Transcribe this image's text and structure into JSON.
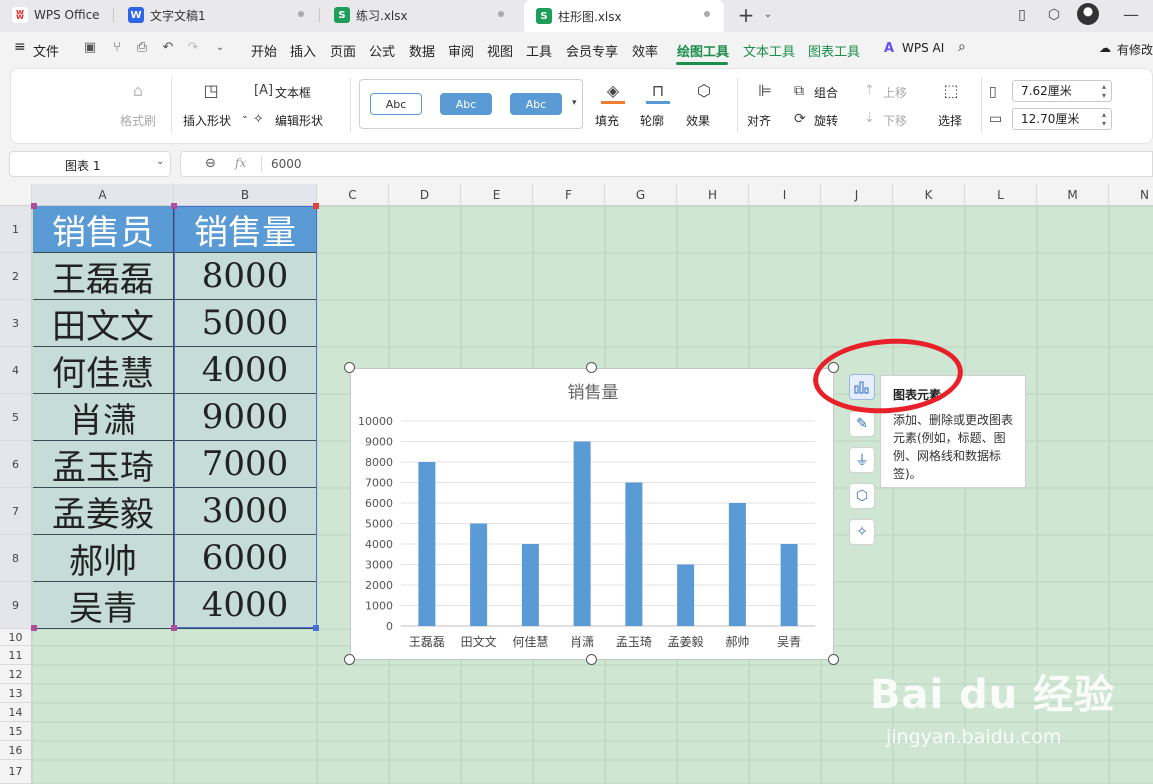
{
  "tabs": [
    {
      "label": "WPS Office",
      "logo": "W"
    },
    {
      "label": "文字文稿1",
      "logo": "W"
    },
    {
      "label": "练习.xlsx",
      "logo": "S"
    },
    {
      "label": "柱形图.xlsx",
      "logo": "S"
    }
  ],
  "menu": {
    "file": "文件",
    "items": [
      "开始",
      "插入",
      "页面",
      "公式",
      "数据",
      "审阅",
      "视图",
      "工具",
      "会员专享",
      "效率"
    ],
    "context_tabs": [
      "绘图工具",
      "文本工具",
      "图表工具"
    ],
    "wps_ai": "WPS AI",
    "modify": "有修改"
  },
  "ribbon": {
    "format_painter": "格式刷",
    "insert_shape": "插入形状",
    "text_box": "文本框",
    "edit_shape": "编辑形状",
    "style_samples": [
      "Abc",
      "Abc",
      "Abc"
    ],
    "fill": "填充",
    "outline": "轮廓",
    "effect": "效果",
    "align": "对齐",
    "group": "组合",
    "rotate": "旋转",
    "bring_forward": "上移",
    "send_backward": "下移",
    "select": "选择",
    "height": "7.62厘米",
    "width": "12.70厘米"
  },
  "formula_bar": {
    "name_box": "图表 1",
    "fx": "fx",
    "value": "6000"
  },
  "columns": [
    "A",
    "B",
    "C",
    "D",
    "E",
    "F",
    "G",
    "H",
    "I",
    "J",
    "K",
    "L",
    "M",
    "N"
  ],
  "rows": [
    "1",
    "2",
    "3",
    "4",
    "5",
    "6",
    "7",
    "8",
    "9",
    "10",
    "11",
    "12",
    "13",
    "14",
    "15",
    "16",
    "17"
  ],
  "table": {
    "headers": [
      "销售员",
      "销售量"
    ],
    "rows": [
      [
        "王磊磊",
        "8000"
      ],
      [
        "田文文",
        "5000"
      ],
      [
        "何佳慧",
        "4000"
      ],
      [
        "肖潇",
        "9000"
      ],
      [
        "孟玉琦",
        "7000"
      ],
      [
        "孟姜毅",
        "3000"
      ],
      [
        "郝帅",
        "6000"
      ],
      [
        "吴青",
        "4000"
      ]
    ]
  },
  "chart_data": {
    "type": "bar",
    "title": "销售量",
    "categories": [
      "王磊磊",
      "田文文",
      "何佳慧",
      "肖潇",
      "孟玉琦",
      "孟姜毅",
      "郝帅",
      "吴青"
    ],
    "values": [
      8000,
      5000,
      4000,
      9000,
      7000,
      3000,
      6000,
      4000
    ],
    "ylim": [
      0,
      10000
    ],
    "yticks": [
      "0",
      "1000",
      "2000",
      "3000",
      "4000",
      "5000",
      "6000",
      "7000",
      "8000",
      "9000",
      "10000"
    ],
    "xlabel": "",
    "ylabel": "",
    "grid": true,
    "bar_color": "#5b9bd5"
  },
  "tooltip": {
    "title": "图表元素",
    "body": "添加、删除或更改图表元素(例如，标题、图例、网格线和数据标签)。"
  },
  "watermark": {
    "main": "Bai du 经验",
    "sub": "jingyan.baidu.com"
  },
  "colors": {
    "accent_green": "#1a8f4c",
    "sheet_bg": "#cfe6d2",
    "header_fill": "#5b9bd5",
    "highlight_ring": "#e8202a"
  }
}
